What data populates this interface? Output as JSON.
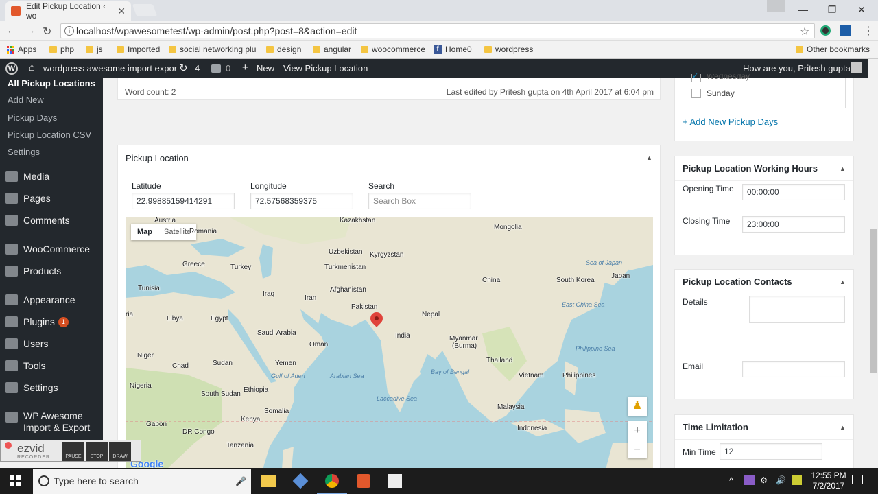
{
  "browser": {
    "tab_title": "Edit Pickup Location ‹ wo",
    "url": "localhost/wpawesometest/wp-admin/post.php?post=8&action=edit",
    "bookmarks": [
      {
        "label": "Apps"
      },
      {
        "label": "php"
      },
      {
        "label": "js"
      },
      {
        "label": "Imported"
      },
      {
        "label": "social networking plu"
      },
      {
        "label": "design"
      },
      {
        "label": "angular"
      },
      {
        "label": "woocommerce"
      },
      {
        "label": "Home0"
      },
      {
        "label": "wordpress"
      }
    ],
    "other_bookmarks": "Other bookmarks"
  },
  "adminbar": {
    "site_name": "wordpress awesome import expor",
    "updates_count": "4",
    "comments_count": "0",
    "new_label": "New",
    "view_label": "View Pickup Location",
    "greeting": "How are you, Pritesh gupta?"
  },
  "sidebar": {
    "submenu": [
      "All Pickup Locations",
      "Add New",
      "Pickup Days",
      "Pickup Location CSV",
      "Settings"
    ],
    "menu": [
      {
        "label": "Media"
      },
      {
        "label": "Pages"
      },
      {
        "label": "Comments"
      },
      {
        "label": "WooCommerce"
      },
      {
        "label": "Products"
      },
      {
        "label": "Appearance"
      },
      {
        "label": "Plugins",
        "badge": "1"
      },
      {
        "label": "Users"
      },
      {
        "label": "Tools"
      },
      {
        "label": "Settings"
      },
      {
        "label": "WP Awesome Import & Export"
      }
    ]
  },
  "editor": {
    "word_count": "Word count: 2",
    "last_edited": "Last edited by Pritesh gupta on 4th April 2017 at 6:04 pm"
  },
  "pickup_location": {
    "title": "Pickup Location",
    "latitude_label": "Latitude",
    "latitude_value": "22.99885159414291",
    "longitude_label": "Longitude",
    "longitude_value": "72.57568359375",
    "search_label": "Search",
    "search_placeholder": "Search Box",
    "map_tab": "Map",
    "satellite_tab": "Satellite",
    "map_labels": [
      "Kazakhstan",
      "Mongolia",
      "Austria",
      "Romania",
      "Uzbekistan",
      "Kyrgyzstan",
      "Greece",
      "Turkey",
      "Turkmenistan",
      "China",
      "South Korea",
      "Japan",
      "Sea of Japan",
      "Tunisia",
      "Iraq",
      "Iran",
      "Afghanistan",
      "Pakistan",
      "East China Sea",
      "ria",
      "Libya",
      "Egypt",
      "Nepal",
      "Saudi Arabia",
      "India",
      "Oman",
      "Myanmar",
      "(Burma)",
      "Niger",
      "Chad",
      "Sudan",
      "Yemen",
      "Gulf of Aden",
      "Arabian Sea",
      "Thailand",
      "Bay of Bengal",
      "Vietnam",
      "Philippines",
      "Nigeria",
      "Ethiopia",
      "South Sudan",
      "Laccadive Sea",
      "Malaysia",
      "Somalia",
      "Kenya",
      "Gabon",
      "DR Congo",
      "Indonesia",
      "Tanzania",
      "Philippine Sea",
      "Google"
    ]
  },
  "right_panel": {
    "days": {
      "wednesday": "Wednesday",
      "sunday": "Sunday",
      "add_new": "+ Add New Pickup Days"
    },
    "hours": {
      "title": "Pickup Location Working Hours",
      "opening_label": "Opening Time",
      "opening_value": "00:00:00",
      "closing_label": "Closing Time",
      "closing_value": "23:00:00"
    },
    "contacts": {
      "title": "Pickup Location Contacts",
      "details_label": "Details",
      "email_label": "Email"
    },
    "limit": {
      "title": "Time Limitation",
      "min_label": "Min Time",
      "min_value": "12"
    }
  },
  "ezvid": {
    "logo": "ezvid",
    "sub": "RECORDER",
    "pause": "PAUSE",
    "stop": "STOP",
    "draw": "DRAW"
  },
  "taskbar": {
    "search_placeholder": "Type here to search",
    "time": "12:55 PM",
    "date": "7/2/2017"
  },
  "colors": {
    "wp_dark": "#23282d",
    "link": "#0073aa",
    "map_water": "#a9d3df",
    "map_land": "#e9e5d3",
    "marker": "#e0433a"
  }
}
